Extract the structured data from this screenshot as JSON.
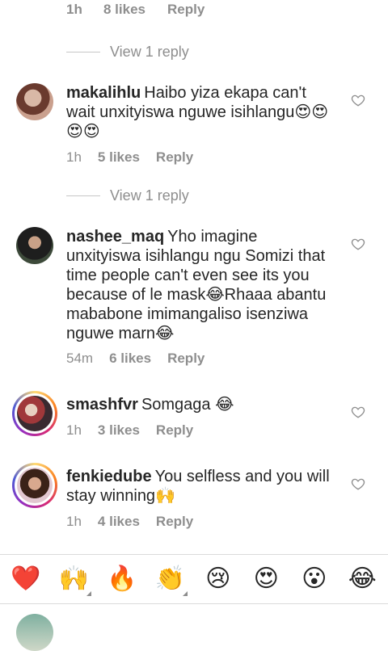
{
  "top_partial": {
    "time": "1h",
    "likes": "8 likes",
    "reply": "Reply"
  },
  "view_replies": [
    "View 1 reply",
    "View 1 reply"
  ],
  "comments": [
    {
      "username": "makalihlu",
      "text": "Haibo yiza ekapa can't wait unxityiswa nguwe isihlangu😍😍😍😍",
      "time": "1h",
      "likes": "5 likes",
      "reply": "Reply"
    },
    {
      "username": "nashee_maq",
      "text": "Yho imagine unxityiswa isihlangu ngu Somizi that time people can't even see its you because of le mask😂Rhaaa abantu mababone imimangaliso isenziwa nguwe marn😂",
      "time": "54m",
      "likes": "6 likes",
      "reply": "Reply"
    },
    {
      "username": "smashfvr",
      "text": "Somgaga 😂",
      "time": "1h",
      "likes": "3 likes",
      "reply": "Reply"
    },
    {
      "username": "fenkiedube",
      "text": "You selfless and you will stay winning🙌",
      "time": "1h",
      "likes": "4 likes",
      "reply": "Reply"
    }
  ],
  "emoji_bar": [
    "❤️",
    "🙌",
    "🔥",
    "👏",
    "😢",
    "😍",
    "😮",
    "😂"
  ],
  "colors": {
    "text": "#262626",
    "secondary": "#8e8e8e",
    "heart": "#ed4956",
    "divider": "#dbdbdb"
  },
  "icons": {
    "like": "heart-outline-icon"
  }
}
